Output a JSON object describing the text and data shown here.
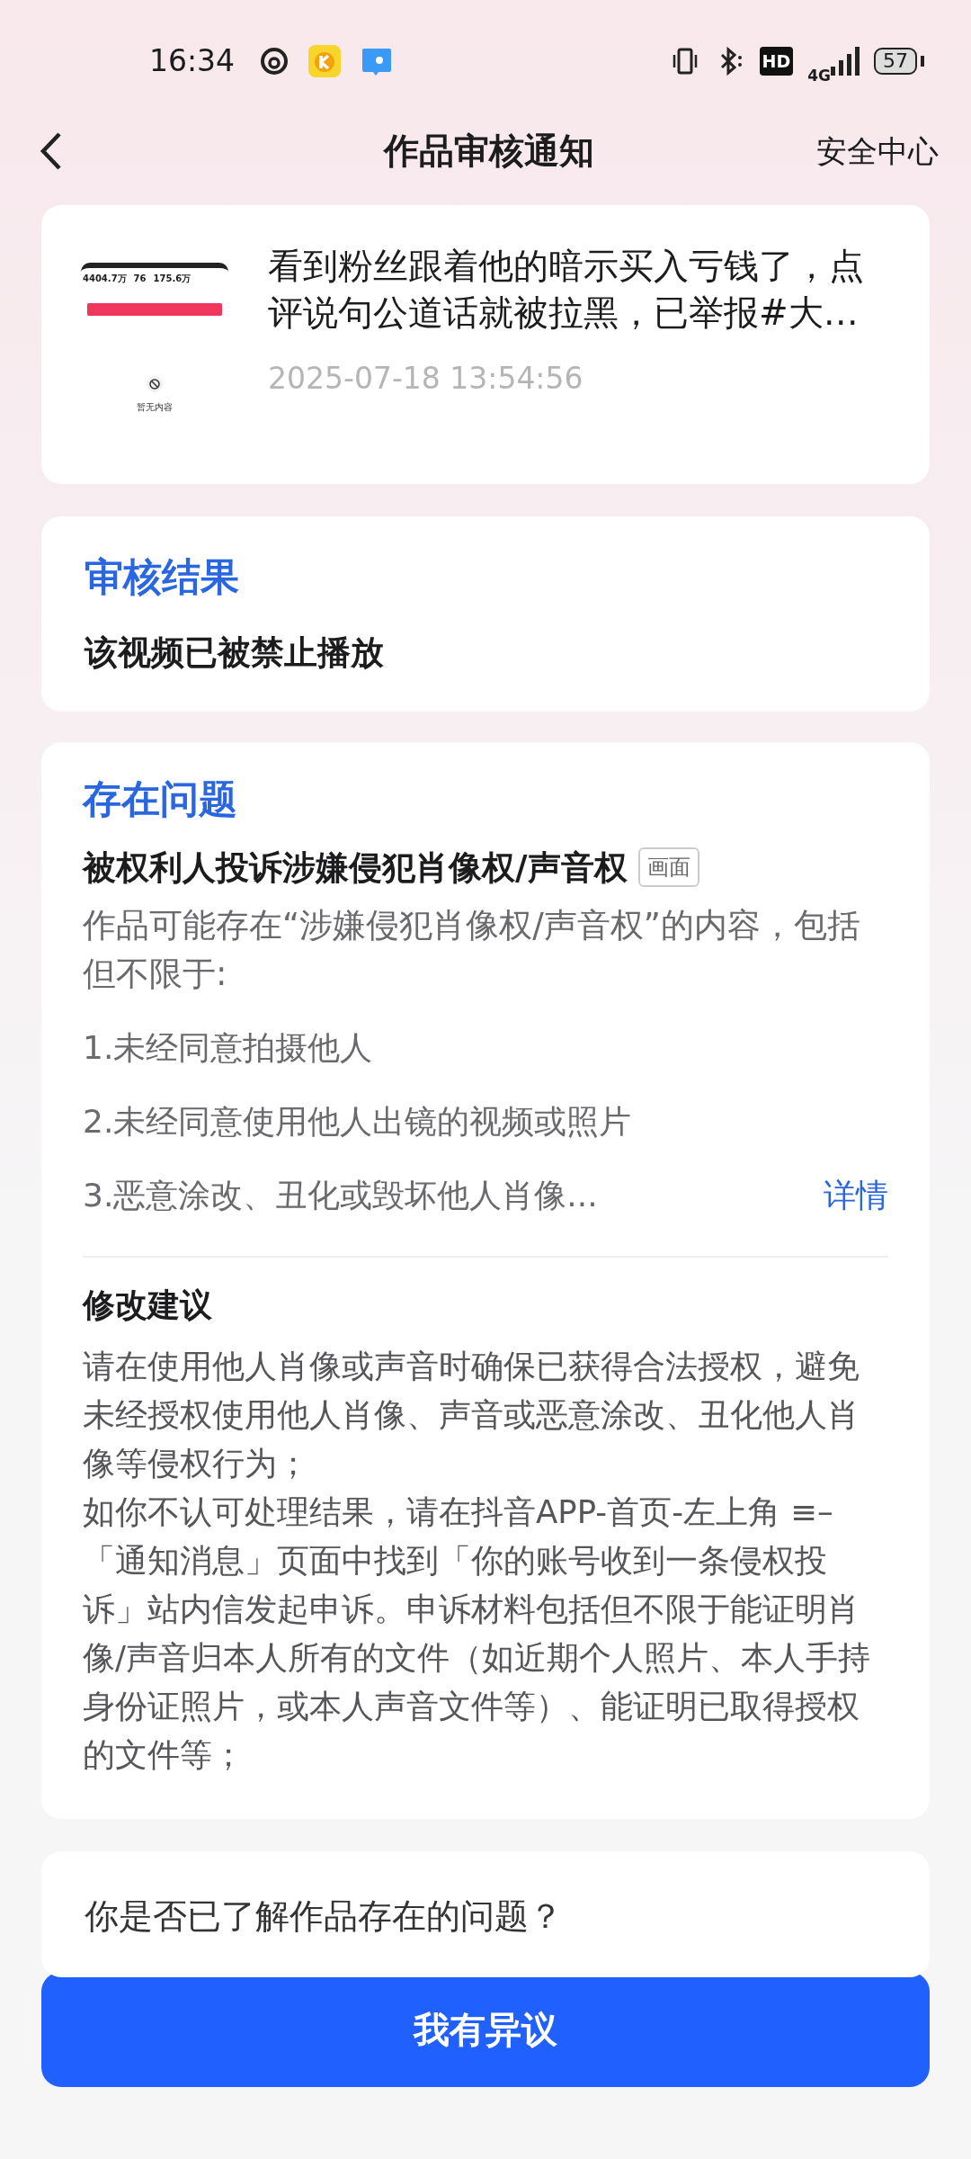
{
  "status_bar": {
    "time": "16:34",
    "hd": "HD",
    "network": "4G",
    "battery": "57"
  },
  "header": {
    "title": "作品审核通知",
    "link": "安全中心"
  },
  "work": {
    "thumbnail": {
      "stats": [
        "4404.7万",
        "76",
        "175.6万"
      ],
      "empty_text": "暂无内容"
    },
    "title": "看到粉丝跟着他的暗示买入亏钱了，点评说句公道话就被拉黑，已举报#大…",
    "time": "2025-07-18 13:54:56"
  },
  "result": {
    "heading": "审核结果",
    "text": "该视频已被禁止播放"
  },
  "issues": {
    "heading": "存在问题",
    "issue_title": "被权利人投诉涉嫌侵犯肖像权/声音权",
    "tag": "画面",
    "description": "作品可能存在“涉嫌侵犯肖像权/声音权”的内容，包括但不限于:",
    "items": [
      "1.未经同意拍摄他人",
      "2.未经同意使用他人出镜的视频或照片",
      "3.恶意涂改、丑化或毁坏他人肖像..."
    ],
    "details_link": "详情",
    "suggestion_heading": "修改建议",
    "suggestion": [
      "请在使用他人肖像或声音时确保已获得合法授权，避免未经授权使用他人肖像、声音或恶意涂改、丑化他人肖像等侵权行为；",
      "如你不认可处理结果，请在抖音APP-首页-左上角 ≡–「通知消息」页面中找到「你的账号收到一条侵权投诉」站内信发起申诉。申诉材料包括但不限于能证明肖像/声音归本人所有的文件（如近期个人照片、本人手持身份证照片，或本人声音文件等）、能证明已取得授权的文件等；"
    ]
  },
  "question": {
    "text": "你是否已了解作品存在的问题？"
  },
  "action_button": {
    "label": "我有异议"
  }
}
